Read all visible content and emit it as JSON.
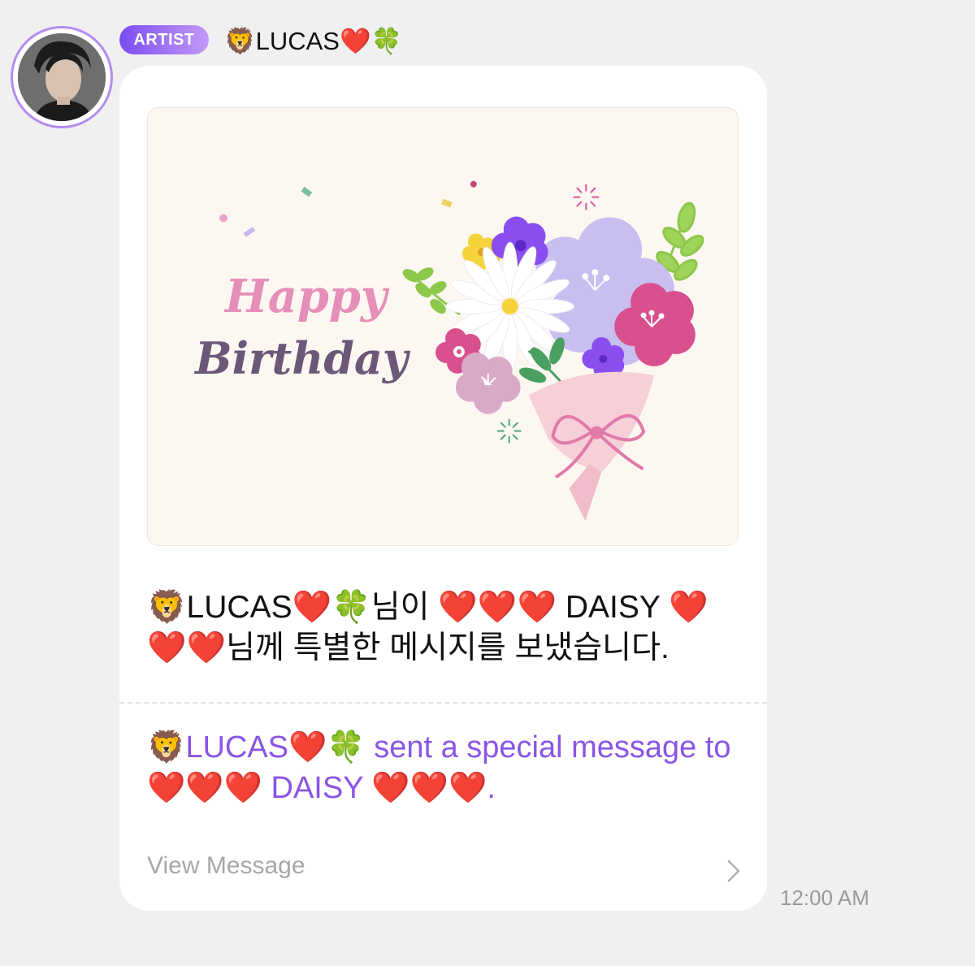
{
  "header": {
    "badge": "ARTIST",
    "sender_name": "🦁LUCAS❤️🍀"
  },
  "card": {
    "image": {
      "line1": "Happy",
      "line2": "Birthday"
    },
    "korean_message": "🦁LUCAS❤️🍀님이 ❤️❤️❤️ DAISY ❤️❤️❤️님께 특별한 메시지를 보냈습니다.",
    "english_message": "🦁LUCAS❤️🍀 sent a special message to ❤️❤️❤️ DAISY ❤️❤️❤️.",
    "view_message_label": "View Message"
  },
  "timestamp": "12:00 AM",
  "colors": {
    "accent": "#8a55e6",
    "badge_start": "#7b4cf2",
    "badge_end": "#c39af8",
    "bubble": "#ffffff",
    "background": "#f0f0f1"
  },
  "icons": {
    "avatar": "artist-profile-photo",
    "chevron": "chevron-right-icon"
  }
}
